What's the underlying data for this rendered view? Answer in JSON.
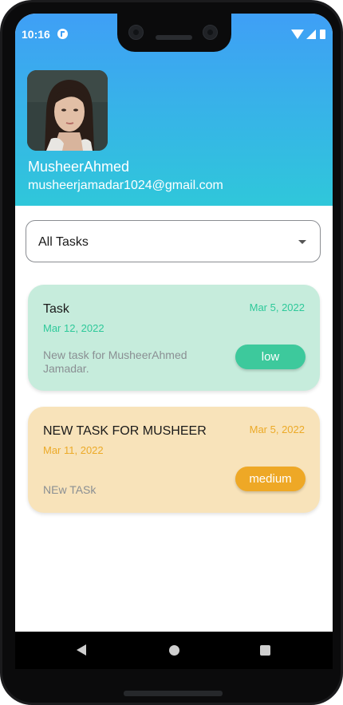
{
  "status_bar": {
    "time": "10:16",
    "icons": [
      "notification-icon",
      "wifi-icon",
      "signal-icon",
      "battery-icon"
    ]
  },
  "profile": {
    "name": "MusheerAhmed",
    "email": "musheerjamadar1024@gmail.com",
    "avatar_icon": "profile-photo"
  },
  "filter": {
    "selected": "All Tasks"
  },
  "tasks": [
    {
      "title": "Task",
      "created_date": "Mar 5, 2022",
      "due_date": "Mar 12, 2022",
      "description": "New task for MusheerAhmed Jamadar.",
      "priority": "low",
      "colors": {
        "background": "#c6ecdc",
        "accent": "#2ec99a",
        "pill": "#3dc99c"
      }
    },
    {
      "title": "NEW TASK FOR MUSHEER",
      "created_date": "Mar 5, 2022",
      "due_date": "Mar 11, 2022",
      "description": "NEw TASk",
      "priority": "medium",
      "colors": {
        "background": "#f8e3ba",
        "accent": "#ecaa28",
        "pill": "#eea826"
      }
    }
  ],
  "nav_bar": {
    "icons": [
      "back-icon",
      "home-icon",
      "recents-icon"
    ]
  },
  "theme": {
    "header_gradient_top": "#3f9ff6",
    "header_gradient_bottom": "#2fc7da"
  }
}
